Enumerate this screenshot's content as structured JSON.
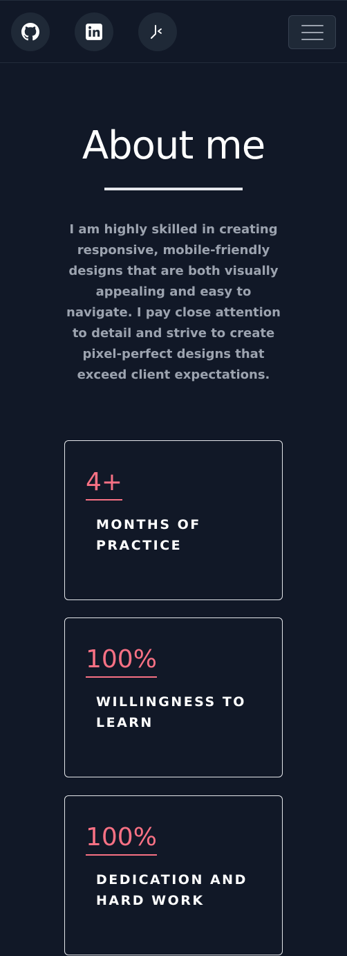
{
  "nav": {
    "icons": [
      "github-icon",
      "linkedin-icon",
      "kattis-icon"
    ],
    "menu_icon": "hamburger-menu-icon"
  },
  "about": {
    "title": "About me",
    "description": "I am highly skilled in creating responsive, mobile-friendly designs that are both visually appealing and easy to navigate. I pay close attention to detail and strive to create pixel-perfect designs that exceed client expectations."
  },
  "stats": [
    {
      "value": "4+",
      "label": "Months of practice"
    },
    {
      "value": "100%",
      "label": "Willingness to learn"
    },
    {
      "value": "100%",
      "label": "Dedication and hard work"
    }
  ],
  "colors": {
    "background": "#111827",
    "accent": "#f87184",
    "muted_text": "#9ca3af"
  }
}
